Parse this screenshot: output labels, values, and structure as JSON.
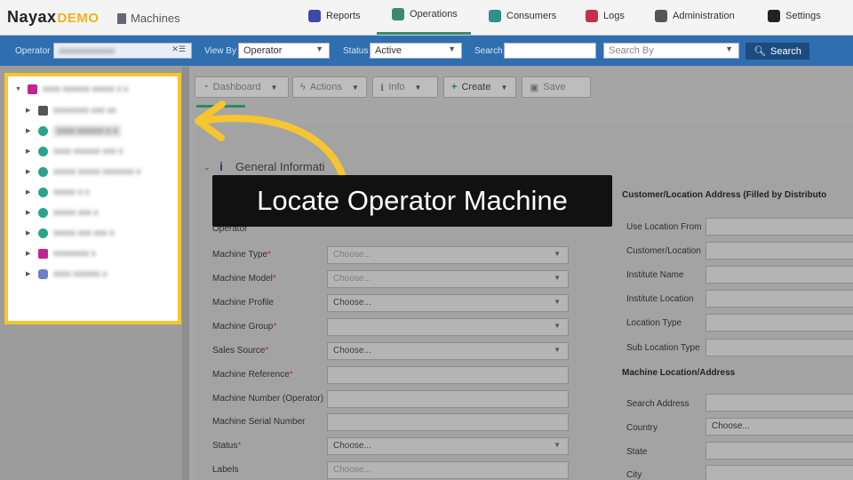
{
  "topnav": {
    "logo_main": "Nayax",
    "logo_demo": "DEMO",
    "breadcrumb": "Machines",
    "items": [
      {
        "label": "Reports",
        "icon": "chart-icon",
        "color": "#3b4aa6"
      },
      {
        "label": "Operations",
        "icon": "operations-icon",
        "color": "#3c8a6e"
      },
      {
        "label": "Consumers",
        "icon": "consumers-icon",
        "color": "#2e8f8f"
      },
      {
        "label": "Logs",
        "icon": "logs-icon",
        "color": "#c0334a"
      },
      {
        "label": "Administration",
        "icon": "admin-icon",
        "color": "#555555"
      },
      {
        "label": "Settings",
        "icon": "gear-icon",
        "color": "#222222"
      }
    ]
  },
  "filterbar": {
    "operator_label": "Operator",
    "view_by_label": "View By",
    "view_by_value": "Operator",
    "status_label": "Status",
    "status_value": "Active",
    "search_label": "Search",
    "search_by_placeholder": "Search By",
    "search_button": "Search"
  },
  "toolbar": {
    "dashboard": "Dashboard",
    "actions": "Actions",
    "info": "Info",
    "create": "Create",
    "save": "Save"
  },
  "form": {
    "section_title": "General Informati",
    "fields": [
      {
        "label": "Operator",
        "required": false,
        "value": "",
        "type": "select"
      },
      {
        "label": "Machine Type",
        "required": true,
        "value": "Choose...",
        "type": "select",
        "placeholder": true
      },
      {
        "label": "Machine Model",
        "required": true,
        "value": "Choose...",
        "type": "select",
        "placeholder": true
      },
      {
        "label": "Machine Profile",
        "required": false,
        "value": "Choose...",
        "type": "select",
        "placeholder": false
      },
      {
        "label": "Machine Group",
        "required": true,
        "value": "",
        "type": "select"
      },
      {
        "label": "Sales Source",
        "required": true,
        "value": "Choose...",
        "type": "select",
        "placeholder": false
      },
      {
        "label": "Machine Reference",
        "required": true,
        "value": "",
        "type": "text"
      },
      {
        "label": "Machine Number (Operator)",
        "required": false,
        "value": "",
        "type": "text"
      },
      {
        "label": "Machine Serial Number",
        "required": false,
        "value": "",
        "type": "text"
      },
      {
        "label": "Status",
        "required": true,
        "value": "Choose...",
        "type": "select",
        "placeholder": false
      },
      {
        "label": "Labels",
        "required": false,
        "value": "Choose...",
        "type": "text",
        "placeholder": true
      }
    ]
  },
  "right": {
    "customer_head": "Customer/Location Address (Filled by Distributo",
    "customer_fields": [
      "Use Location From",
      "Customer/Location",
      "Institute Name",
      "Institute Location",
      "Location Type",
      "Sub Location Type"
    ],
    "machine_loc_head": "Machine Location/Address",
    "machine_loc_fields": [
      {
        "label": "Search Address",
        "value": ""
      },
      {
        "label": "Country",
        "value": "Choose..."
      },
      {
        "label": "State",
        "value": ""
      },
      {
        "label": "City",
        "value": ""
      }
    ]
  },
  "callout": "Locate Operator Machine",
  "tree_colors": {
    "operator": "#c0268f",
    "machine": "#2aa38a",
    "folder": "#555555"
  }
}
